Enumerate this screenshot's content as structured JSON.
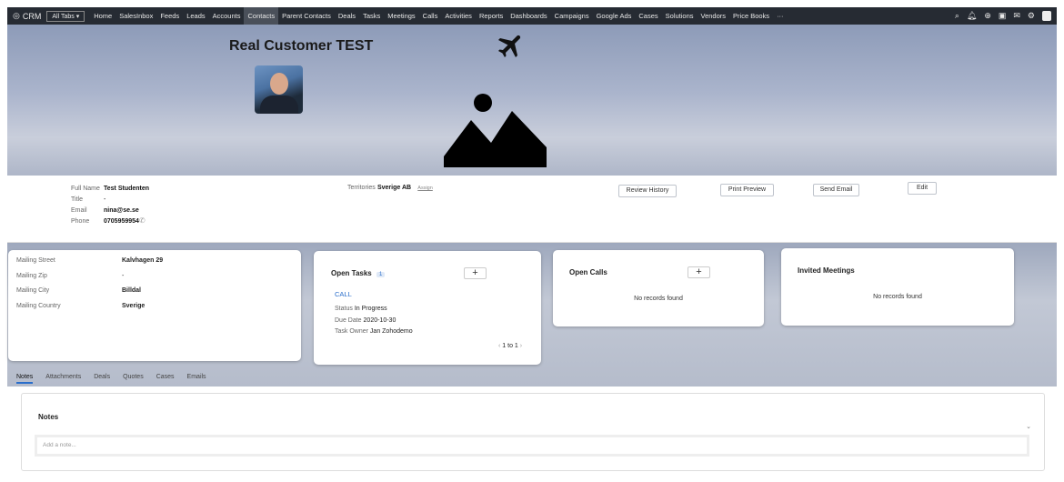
{
  "nav": {
    "brand": "CRM",
    "all_tabs": "All Tabs ▾",
    "items": [
      "Home",
      "SalesInbox",
      "Feeds",
      "Leads",
      "Accounts",
      "Contacts",
      "Parent Contacts",
      "Deals",
      "Tasks",
      "Meetings",
      "Calls",
      "Activities",
      "Reports",
      "Dashboards",
      "Campaigns",
      "Google Ads",
      "Cases",
      "Solutions",
      "Vendors",
      "Price Books",
      "···"
    ],
    "active": "Contacts"
  },
  "header": {
    "title": "Real Customer TEST"
  },
  "info": {
    "full_name_label": "Full Name",
    "full_name": "Test Studenten",
    "title_label": "Title",
    "title": "-",
    "email_label": "Email",
    "email": "nina@se.se",
    "phone_label": "Phone",
    "phone": "0705959954",
    "territories_label": "Territories",
    "territories": "Sverige AB",
    "assign": "Assign",
    "review_history": "Review History",
    "print_preview": "Print Preview",
    "send_email": "Send Email",
    "edit": "Edit"
  },
  "address": {
    "street_label": "Mailing Street",
    "street": "Kalvhagen 29",
    "zip_label": "Mailing Zip",
    "zip": "-",
    "city_label": "Mailing City",
    "city": "Billdal",
    "country_label": "Mailing Country",
    "country": "Sverige"
  },
  "open_tasks": {
    "title": "Open Tasks",
    "count": "1",
    "plus": "+",
    "task": {
      "subject": "CALL",
      "status_label": "Status",
      "status": "In Progress",
      "due_label": "Due Date",
      "due": "2020-10-30",
      "owner_label": "Task Owner",
      "owner": "Jan Zohodemo"
    },
    "pagination": "1 to 1"
  },
  "open_calls": {
    "title": "Open Calls",
    "plus": "+",
    "empty": "No records found"
  },
  "invited_meetings": {
    "title": "Invited Meetings",
    "empty": "No records found"
  },
  "tabs": [
    "Notes",
    "Attachments",
    "Deals",
    "Quotes",
    "Cases",
    "Emails"
  ],
  "notes": {
    "title": "Notes",
    "placeholder": "Add a note..."
  }
}
